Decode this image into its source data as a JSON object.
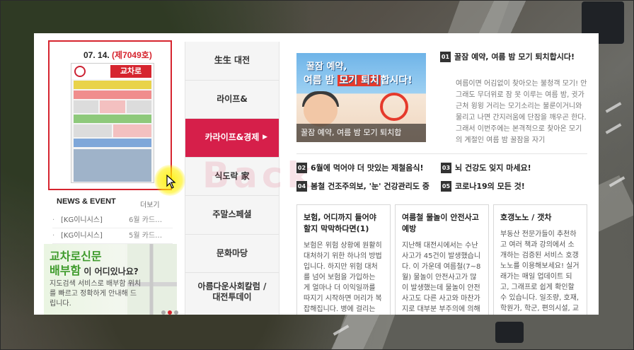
{
  "newspaper": {
    "date": "07. 14.",
    "issue": "(제7049호)",
    "logo_text": "교차로"
  },
  "news": {
    "heading": "NEWS & EVENT",
    "more": "더보기",
    "items": [
      {
        "title": "[KG이니시스]",
        "date": "6월 카드…"
      },
      {
        "title": "[KG이니시스]",
        "date": "5월 카드…"
      }
    ]
  },
  "map_banner": {
    "line1": "교차로신문",
    "line2": "배부함",
    "line2_suffix": " 이 어디있나요?",
    "desc": "지도검색 서비스로 배부함 위치를 빠르고 정확하게 안내해 드립니다."
  },
  "menu": [
    {
      "label": "生生 대전",
      "active": false
    },
    {
      "label": "라이프&",
      "active": false
    },
    {
      "label": "카라이프&경제",
      "active": true
    },
    {
      "label": "식도락 家",
      "active": false
    },
    {
      "label": "주말스페셜",
      "active": false
    },
    {
      "label": "문화마당",
      "active": false
    },
    {
      "label": "아름다운사회칼럼 / 대전투데이",
      "active": false
    }
  ],
  "menu_arrow": "▶",
  "feature": {
    "img_line1": "꿀잠 예약,",
    "img_line2a": "여름 밤 ",
    "img_line2b": "모기 퇴치",
    "img_line2c": "합시다!",
    "caption": "꿀잠 예약, 여름 밤 모기 퇴치합",
    "num": "01",
    "title": "꿀잠 예약, 여름 밤 모기 퇴치합시다!",
    "body": "여름이면 어김없이 찾아오는 불청객 모기! 안 그래도 무더위로 잠 못 이루는 여름 밤, 귓가 근처 윙윙 거리는 모기소리는 불룬이거니와 물리고 나면 간지러움에 단잠을 깨우곤 한다. 그래서 이번주에는 본격적으로 찾아온 모기의 계절인 여름 밤 꿀잠을 자기"
  },
  "mid_items": [
    {
      "num": "02",
      "title": "6월에 먹어야 더 맛있는 제철음식!"
    },
    {
      "num": "03",
      "title": "뇌 건강도 잊지 마세요!"
    },
    {
      "num": "04",
      "title": "봄철 건조주의보, '눈' 건강관리도 중"
    },
    {
      "num": "05",
      "title": "코로나19의 모든 것!"
    }
  ],
  "cards": [
    {
      "title": "보험, 어디까지 들어야할지 막막하다면(1)",
      "body": "보험은 위험 상황에 원활히 대처하기 위한 하나의 방법입니다. 하지만 위험 대처를 넘어 보험을 가입하는 게 얼마나 더 이익일까를 따지기 시작하면 머리가 복잡해집니다. 병에 걸리는"
    },
    {
      "title": "여름철 물놀이 안전사고 예방",
      "body": "지난해 대전시에서는 수난사고가 45건이 발생했습니다. 이 가운데 여름철(7~8월) 물놀이 안전사고가 많이 발생했는데 물놀이 안전사고도 다른 사고와 마찬가지로 대부분 부주의에 의해"
    },
    {
      "title": "호갱노노 / 갯차",
      "body": "부동산 전문가들이 추천하고 여러 책과 강의에서 소개하는 검증된 서비스 호갱노노를 이용해보세요! 실거래가는 매일 업데이트 되고, 그래프로 쉽게 확인할 수 있습니다. 일조량, 호재, 학원가, 학군, 편의시설, 교"
    }
  ],
  "watermark": "Back",
  "colors": {
    "accent": "#d61f4a",
    "issue_red": "#d6252f",
    "banner_green": "#3f9b2c"
  }
}
